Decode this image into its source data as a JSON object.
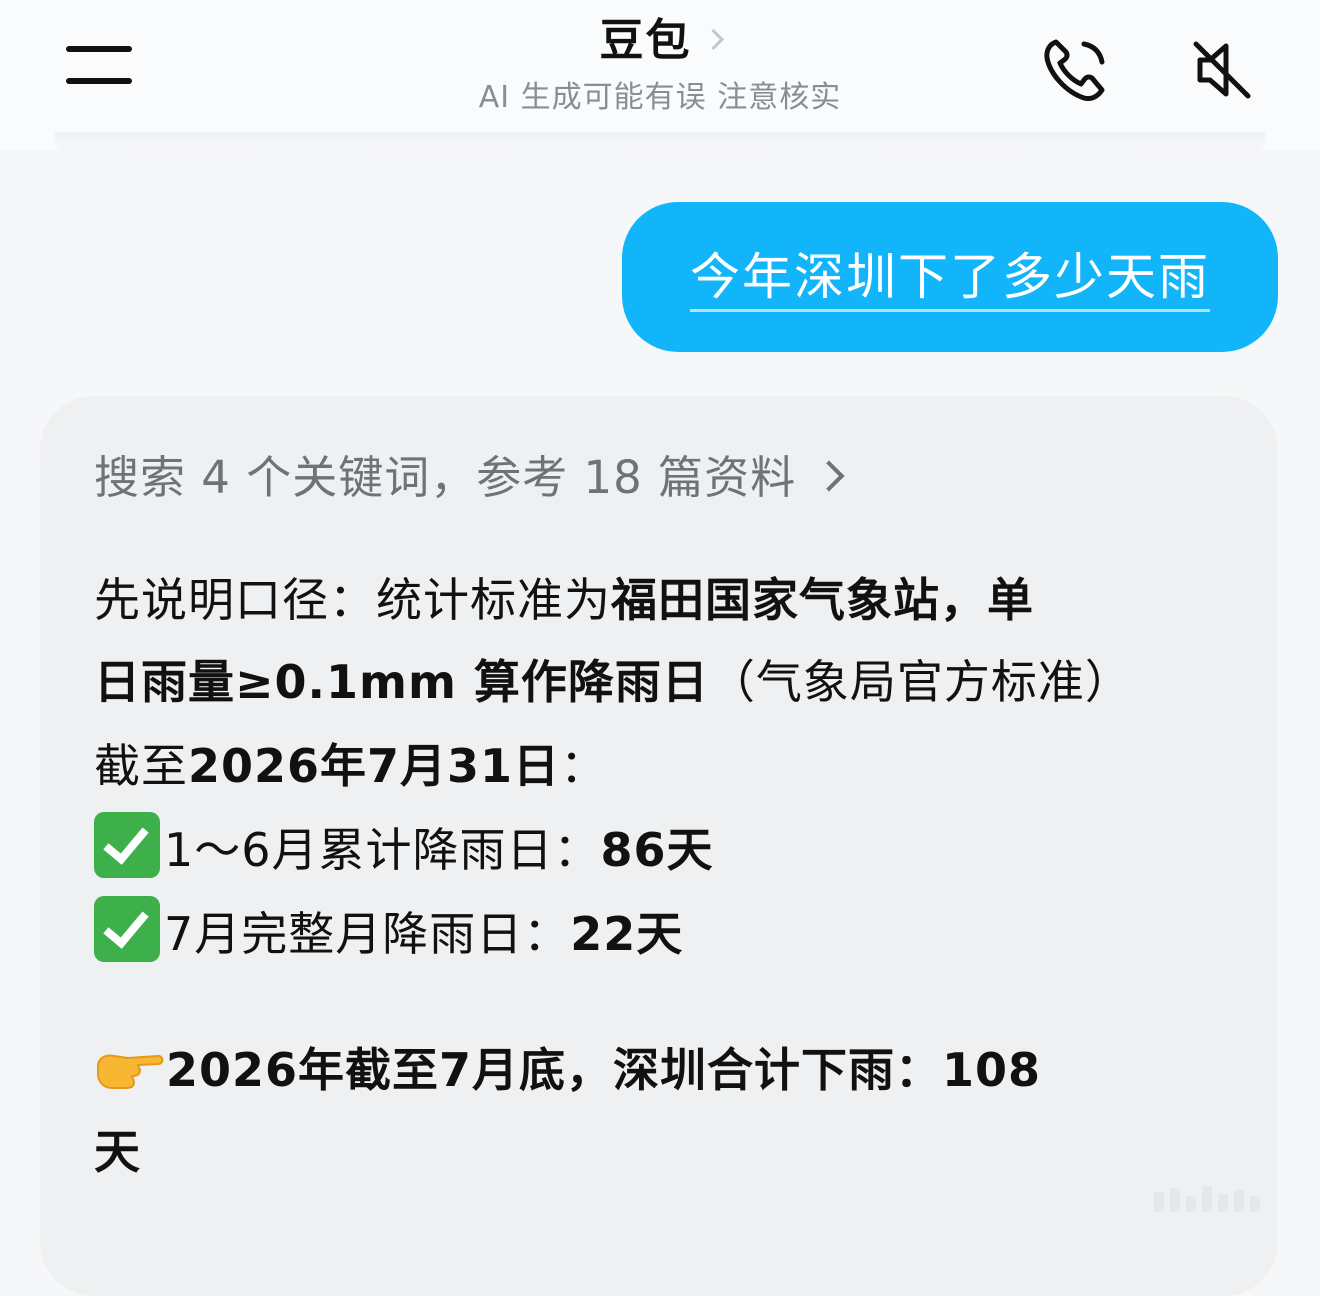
{
  "header": {
    "title": "豆包",
    "subtitle": "AI 生成可能有误 注意核实",
    "icons": {
      "menu": "menu-icon",
      "phone": "phone-icon",
      "mute": "speaker-muted-icon"
    }
  },
  "chat": {
    "user_message": "今年深圳下了多少天雨",
    "bubble_color": "#12b5fa",
    "reply": {
      "search_summary": "搜索 4 个关键词，参考 18 篇资料",
      "line1_prefix": "先说明口径：统计标准为",
      "line1_bold": "福田国家气象站，单",
      "line2_bold": "日雨量≥0.1mm 算作降雨日",
      "line2_normal": "（气象局官方标准）",
      "line3_normal": "截至",
      "line3_bold": "2026年7月31日",
      "line3_suffix": "：",
      "item1_label": "1～6月累计降雨日：",
      "item1_value": "86天",
      "item2_label": "7月完整月降雨日：",
      "item2_value": "22天",
      "conclusion": "2026年截至7月底，深圳合计下雨：108",
      "conclusion_tail": "天"
    }
  }
}
